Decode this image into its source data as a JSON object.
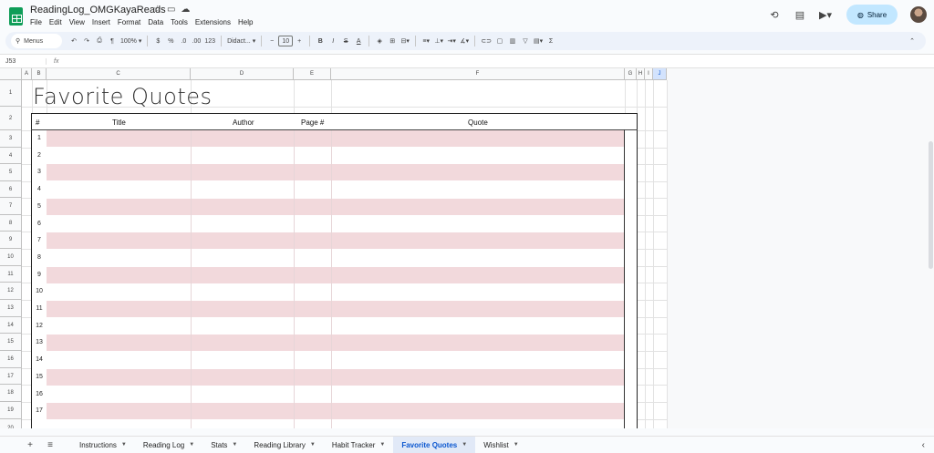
{
  "app": {
    "document_title": "ReadingLog_OMGKayaReads",
    "menu": [
      "File",
      "Edit",
      "View",
      "Insert",
      "Format",
      "Data",
      "Tools",
      "Extensions",
      "Help"
    ],
    "share_label": "Share"
  },
  "toolbar": {
    "menus_label": "Menus",
    "zoom": "100%",
    "currency": "$",
    "percent": "%",
    "dec_decrease": ".0",
    "dec_increase": ".00",
    "number_format": "123",
    "font": "Didact...",
    "font_size": "10",
    "bold": "B",
    "italic": "I",
    "strike": "S",
    "text_color": "A",
    "sum": "Σ"
  },
  "formula_bar": {
    "name_box": "J53",
    "fx": "fx",
    "content": ""
  },
  "columns": [
    {
      "id": "A",
      "selected": false
    },
    {
      "id": "B",
      "selected": false
    },
    {
      "id": "C",
      "selected": false
    },
    {
      "id": "D",
      "selected": false
    },
    {
      "id": "E",
      "selected": false
    },
    {
      "id": "F",
      "selected": false
    },
    {
      "id": "G",
      "selected": false
    },
    {
      "id": "H",
      "selected": false
    },
    {
      "id": "I",
      "selected": false
    },
    {
      "id": "J",
      "selected": true
    }
  ],
  "row_numbers": [
    "1",
    "2",
    "3",
    "4",
    "5",
    "6",
    "7",
    "8",
    "9",
    "10",
    "11",
    "12",
    "13",
    "14",
    "15",
    "16",
    "17",
    "18",
    "19",
    "20"
  ],
  "sheet": {
    "title": "Favorite Quotes",
    "headers": {
      "num": "#",
      "title": "Title",
      "author": "Author",
      "page": "Page #",
      "quote": "Quote"
    },
    "entries": [
      "1",
      "2",
      "3",
      "4",
      "5",
      "6",
      "7",
      "8",
      "9",
      "10",
      "11",
      "12",
      "13",
      "14",
      "15",
      "16",
      "17"
    ],
    "stripe_color": "#f2d9dc"
  },
  "tabs": [
    {
      "label": "Instructions",
      "active": false
    },
    {
      "label": "Reading Log",
      "active": false
    },
    {
      "label": "Stats",
      "active": false
    },
    {
      "label": "Reading Library",
      "active": false
    },
    {
      "label": "Habit Tracker",
      "active": false
    },
    {
      "label": "Favorite Quotes",
      "active": true
    },
    {
      "label": "Wishlist",
      "active": false
    }
  ]
}
